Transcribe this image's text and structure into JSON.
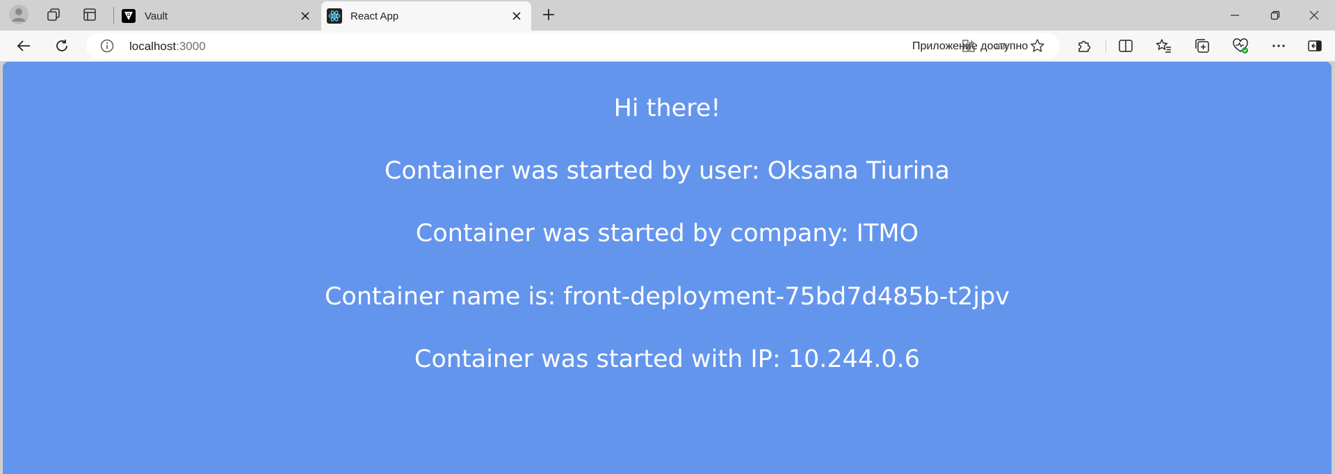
{
  "browser": {
    "tabs": [
      {
        "title": "Vault",
        "favicon": "vault-icon",
        "active": false
      },
      {
        "title": "React App",
        "favicon": "react-icon",
        "active": true
      }
    ],
    "address": {
      "host": "localhost",
      "port": ":3000"
    },
    "app_available_label": "Приложение доступно"
  },
  "page": {
    "greeting": "Hi there!",
    "started_by_user": "Container was started by user: Oksana Tiurina",
    "started_by_company": "Container was started by company: ITMO",
    "container_name": "Container name is: front-deployment-75bd7d485b-t2jpv",
    "started_with_ip": "Container was started with IP: 10.244.0.6"
  },
  "colors": {
    "page_background": "#6495ed",
    "page_text": "#ffffff"
  }
}
